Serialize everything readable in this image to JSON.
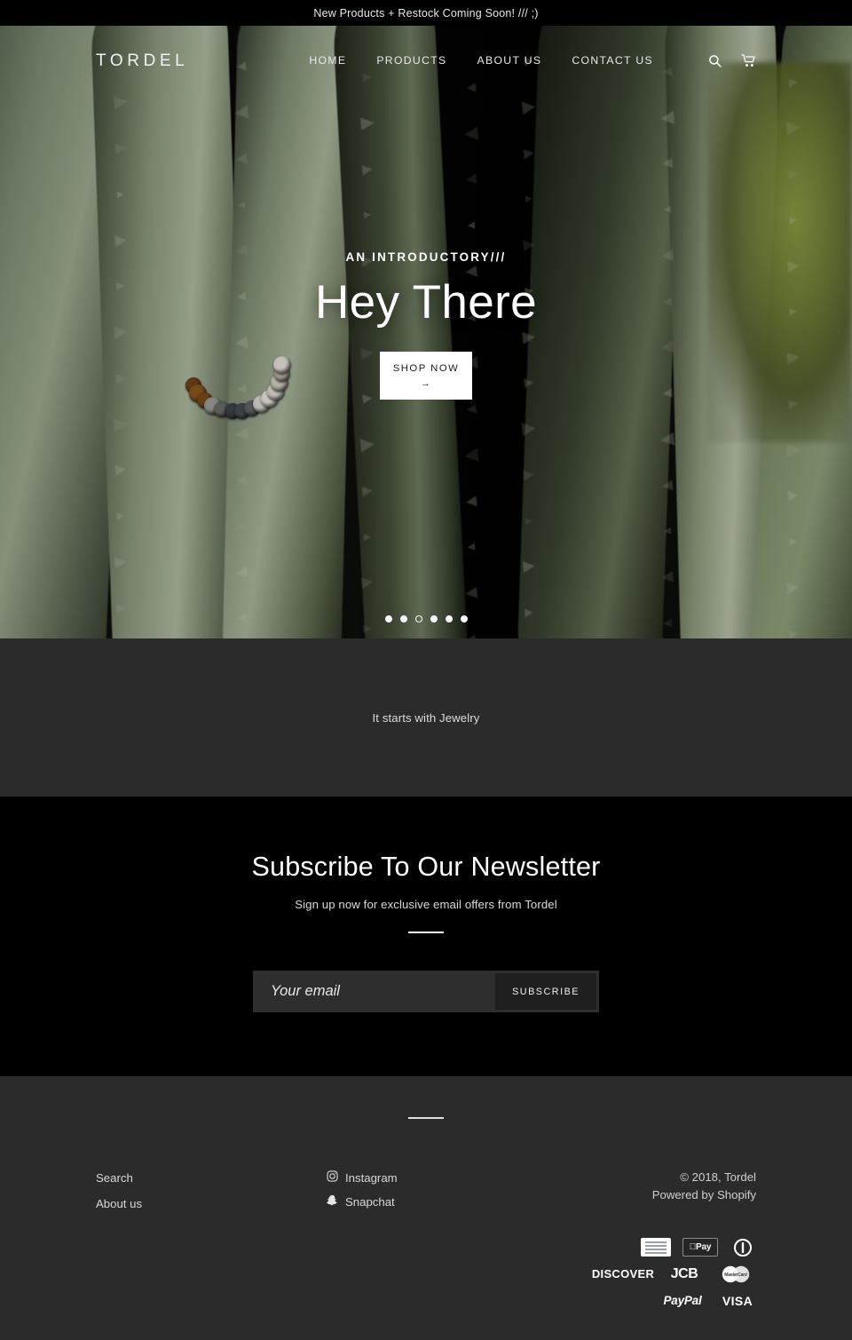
{
  "announcement": {
    "text": "New Products + Restock Coming Soon! /// ;)"
  },
  "header": {
    "logo": "TORDEL",
    "nav": [
      {
        "label": "HOME"
      },
      {
        "label": "PRODUCTS"
      },
      {
        "label": "ABOUT US"
      },
      {
        "label": "CONTACT US"
      }
    ],
    "icons": [
      {
        "name": "search-icon",
        "label": "Search"
      },
      {
        "name": "cart-icon",
        "label": "Cart"
      }
    ]
  },
  "hero": {
    "eyebrow": "AN INTRODUCTORY///",
    "title": "Hey There",
    "cta_label": "SHOP NOW",
    "cta_arrow": "→",
    "slide_count": 6,
    "active_slide": 3
  },
  "jewelry": {
    "text": "It starts with Jewelry"
  },
  "newsletter": {
    "title": "Subscribe To Our Newsletter",
    "subtitle": "Sign up now for exclusive email offers from Tordel",
    "email_placeholder": "Your email",
    "email_value": "",
    "subscribe_label": "SUBSCRIBE"
  },
  "footer": {
    "links": [
      {
        "label": "Search"
      },
      {
        "label": "About us"
      }
    ],
    "social": [
      {
        "label": "Instagram",
        "icon": "instagram-icon"
      },
      {
        "label": "Snapchat",
        "icon": "snapchat-icon"
      }
    ],
    "copyright": "© 2018, Tordel",
    "powered_by_prefix": "Powered by ",
    "powered_by_link": "Shopify",
    "payments": [
      {
        "name": "american-express",
        "label": "AMEX"
      },
      {
        "name": "apple-pay",
        "label": "Pay"
      },
      {
        "name": "diners-club",
        "label": "Diners Club"
      },
      {
        "name": "discover",
        "label": "DISCOVER"
      },
      {
        "name": "jcb",
        "label": "JCB"
      },
      {
        "name": "mastercard",
        "label": "MasterCard"
      },
      {
        "name": "paypal",
        "label": "PayPal"
      },
      {
        "name": "visa",
        "label": "VISA"
      }
    ]
  },
  "colors": {
    "page_black": "#000000",
    "panel_gray": "#2b2b2b",
    "input_gray": "#2e2e2e",
    "text_light": "#e8e8e8",
    "accent_white": "#ffffff"
  }
}
